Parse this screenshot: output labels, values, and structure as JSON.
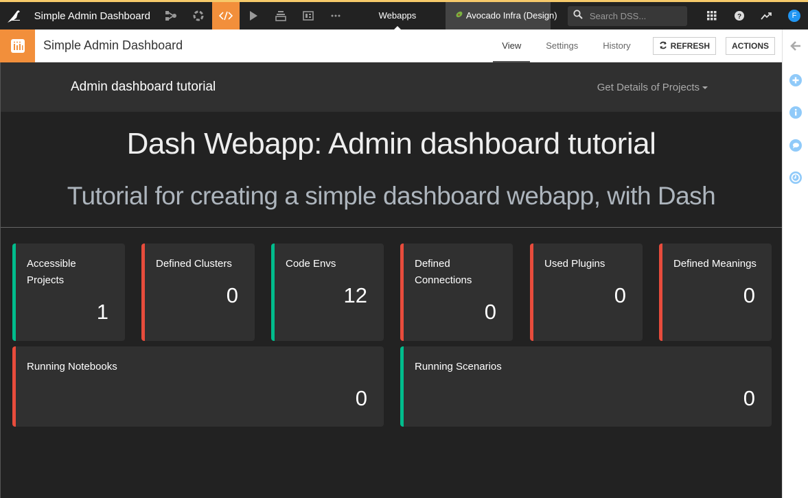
{
  "topbar": {
    "project_name": "Simple Admin Dashboard",
    "nav_icons": [
      "flow-icon",
      "circle-dots-icon",
      "code-icon",
      "play-icon",
      "stack-icon",
      "dashboard-icon",
      "more-icon"
    ],
    "section_label": "Webapps",
    "instance_label": "Avocado Infra (Design)",
    "search_placeholder": "Search DSS...",
    "avatar_letter": "F"
  },
  "subbar": {
    "title": "Simple Admin Dashboard",
    "tabs": [
      {
        "label": "View",
        "active": true
      },
      {
        "label": "Settings",
        "active": false
      },
      {
        "label": "History",
        "active": false
      }
    ],
    "refresh_label": "REFRESH",
    "actions_label": "ACTIONS"
  },
  "app": {
    "nav_title": "Admin dashboard tutorial",
    "nav_dropdown": "Get Details of Projects",
    "heading": "Dash Webapp: Admin dashboard tutorial",
    "subheading": "Tutorial for creating a simple dashboard webapp, with Dash",
    "colors": {
      "good": "#00bc8c",
      "bad": "#e74c3c",
      "accent": "#f28f3b"
    },
    "cards": [
      {
        "label": "Accessible Projects",
        "value": "1",
        "status": "good"
      },
      {
        "label": "Defined Clusters",
        "value": "0",
        "status": "bad"
      },
      {
        "label": "Code Envs",
        "value": "12",
        "status": "good"
      },
      {
        "label": "Defined Connections",
        "value": "0",
        "status": "bad"
      },
      {
        "label": "Used Plugins",
        "value": "0",
        "status": "bad"
      },
      {
        "label": "Defined Meanings",
        "value": "0",
        "status": "bad"
      },
      {
        "label": "Running Notebooks",
        "value": "0",
        "status": "bad"
      },
      {
        "label": "Running Scenarios",
        "value": "0",
        "status": "good"
      }
    ]
  }
}
